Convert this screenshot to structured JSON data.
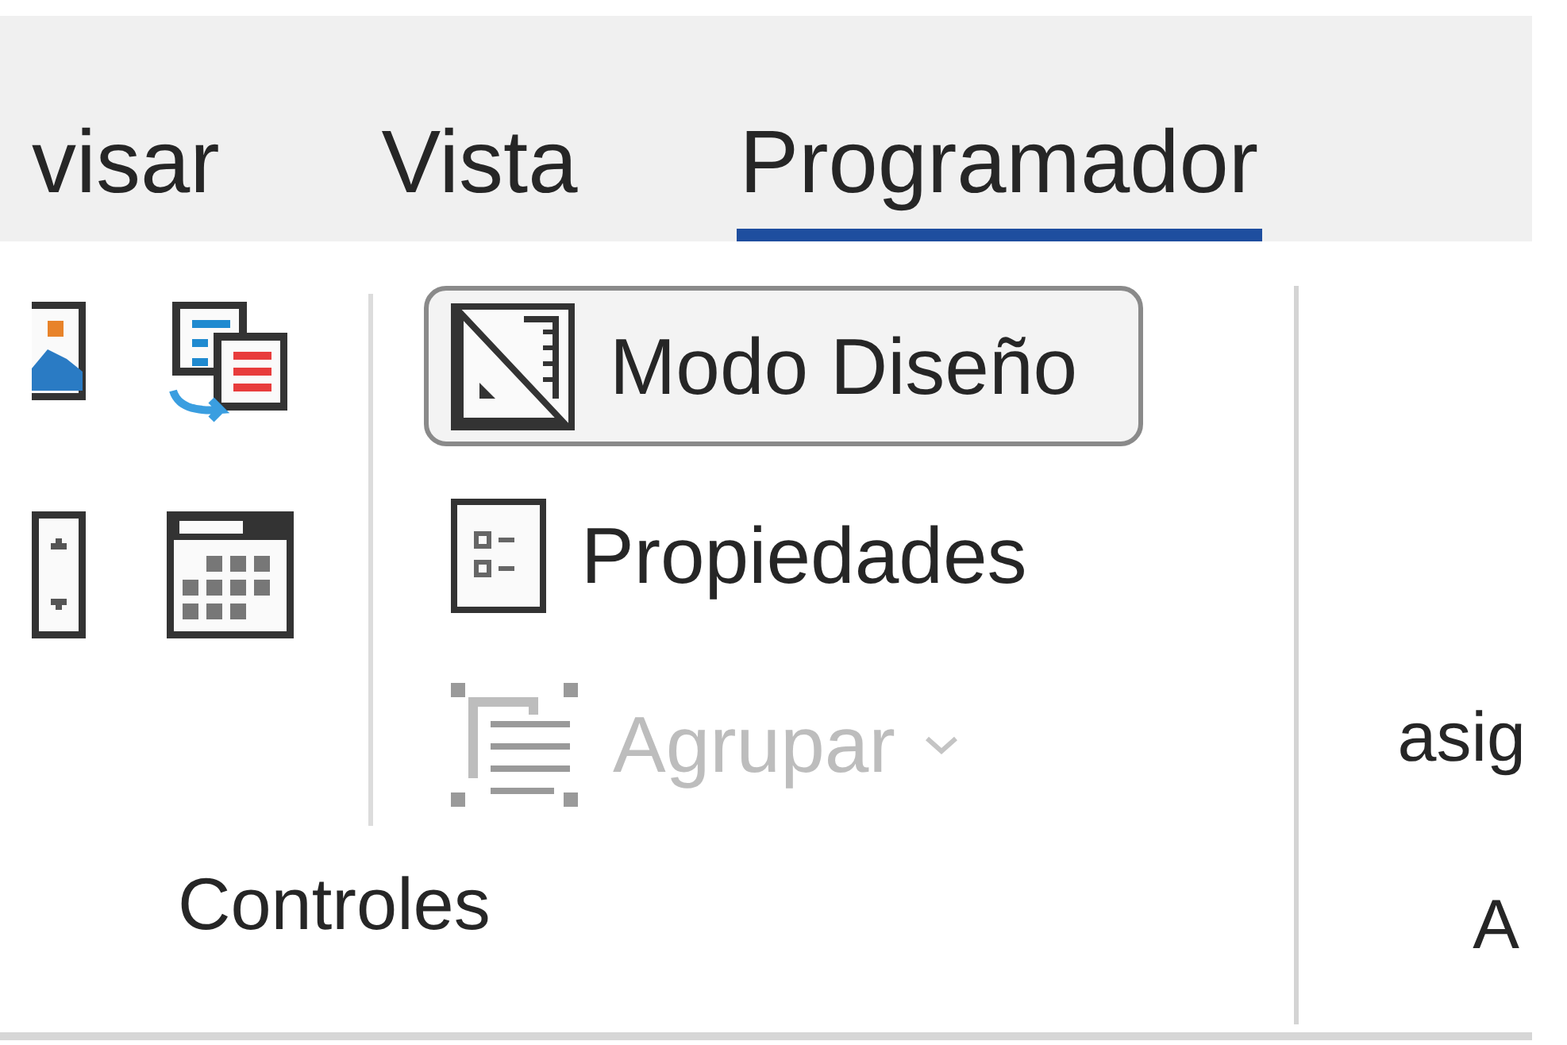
{
  "tabs": [
    {
      "label": "visar",
      "selected": false
    },
    {
      "label": "Vista",
      "selected": false
    },
    {
      "label": "Programador",
      "selected": true
    }
  ],
  "controls": [
    {
      "kind": "design",
      "label": "Modo Diseño",
      "on": true,
      "disabled": false
    },
    {
      "kind": "properties",
      "label": "Propiedades",
      "on": false,
      "disabled": false
    },
    {
      "kind": "group",
      "label": "Agrupar",
      "on": false,
      "disabled": true,
      "dropdown": true
    }
  ],
  "group_label": "Controles",
  "next_group": {
    "text": "asig",
    "label": "A"
  }
}
